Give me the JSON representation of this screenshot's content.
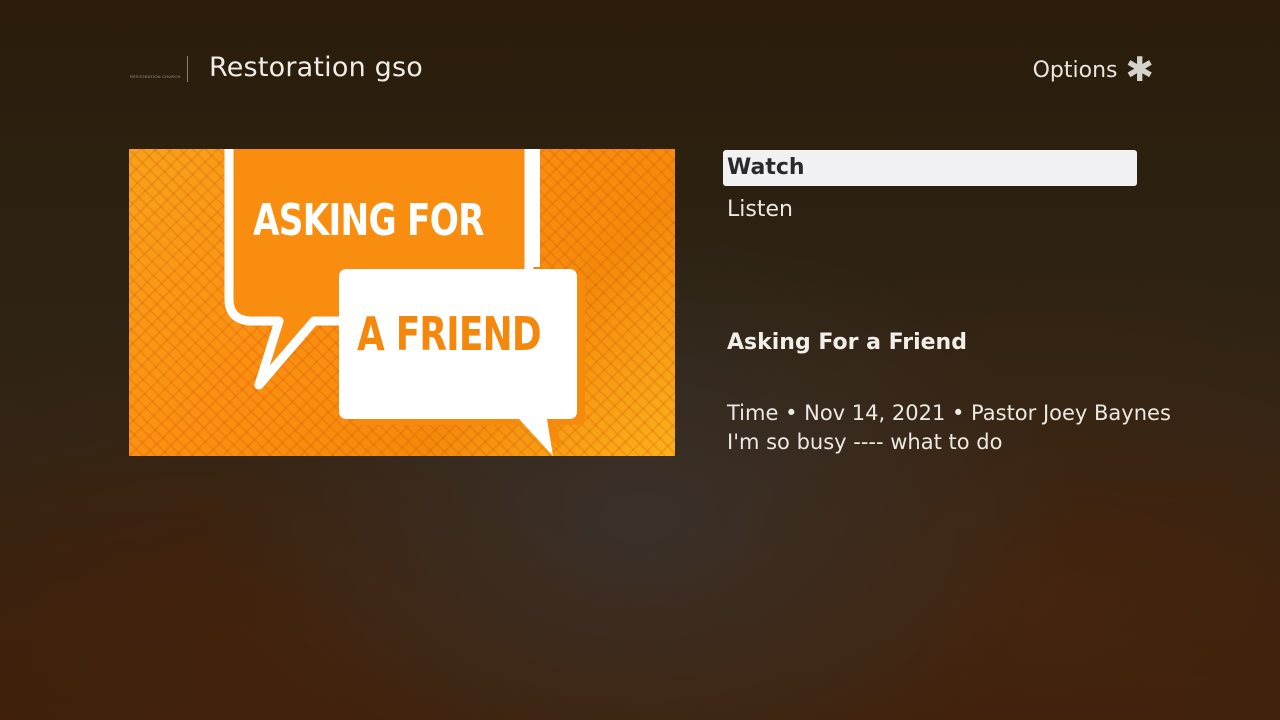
{
  "header": {
    "logo_text": "RESTORATION CHURCH",
    "title": "Restoration gso",
    "options_label": "Options",
    "options_icon": "asterisk-icon"
  },
  "artwork": {
    "line1": "ASKING FOR",
    "line2": "A FRIEND",
    "colors": {
      "background": "#f7a21a",
      "accent": "#f4880c",
      "bubble": "#ffffff"
    }
  },
  "menu": {
    "items": [
      {
        "label": "Watch",
        "selected": true
      },
      {
        "label": "Listen",
        "selected": false
      }
    ]
  },
  "details": {
    "title": "Asking For a Friend",
    "meta": "Time • Nov 14, 2021 • Pastor Joey Baynes",
    "description": "I'm so busy ---- what to do"
  },
  "colors": {
    "selection_background": "#f1f1f3",
    "text": "#ece8e2"
  }
}
